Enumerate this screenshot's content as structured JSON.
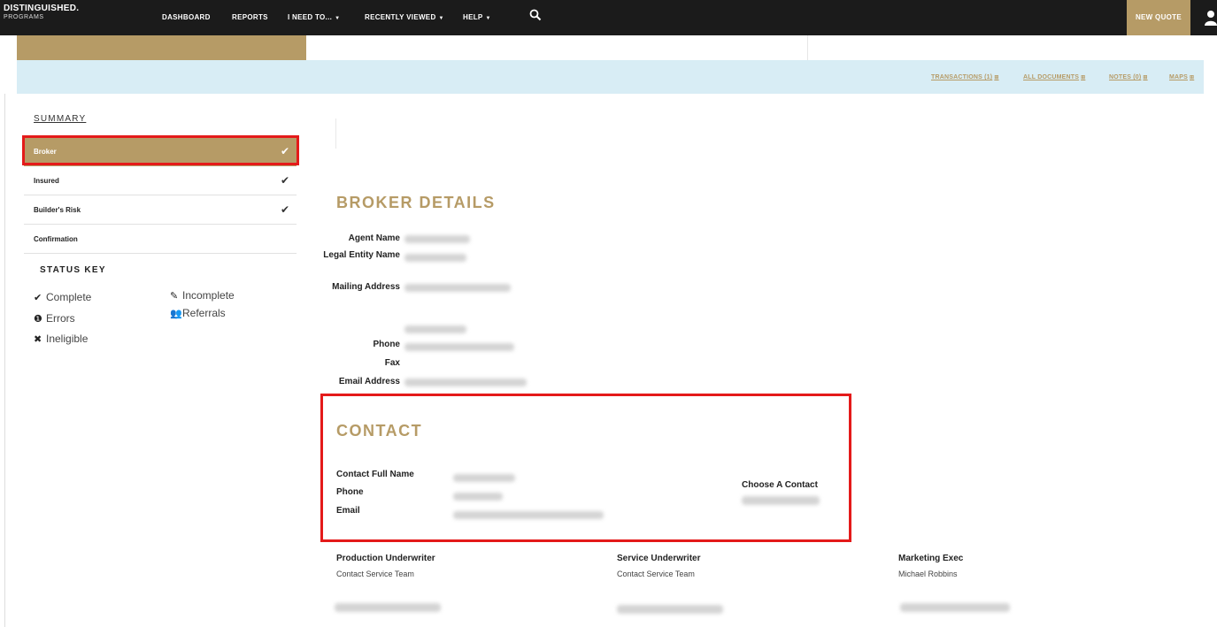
{
  "brand": {
    "line1": "DISTINGUISHED.",
    "line2": "PROGRAMS"
  },
  "nav": {
    "dashboard": "DASHBOARD",
    "reports": "REPORTS",
    "i_need_to": "I NEED TO...",
    "recently_viewed": "RECENTLY VIEWED",
    "help": "HELP",
    "new_quote": "NEW QUOTE"
  },
  "band_links": {
    "transactions": "TRANSACTIONS (1)",
    "all_documents": "ALL DOCUMENTS",
    "notes": "NOTES (0)",
    "maps": "MAPS"
  },
  "sidebar": {
    "summary": "SUMMARY",
    "steps": [
      {
        "label": "Broker",
        "done": true
      },
      {
        "label": "Insured",
        "done": true
      },
      {
        "label": "Builder's Risk",
        "done": true
      },
      {
        "label": "Confirmation",
        "done": false
      }
    ],
    "status_key": {
      "title": "STATUS KEY",
      "complete": "Complete",
      "incomplete": "Incomplete",
      "errors": "Errors",
      "referrals": "Referrals",
      "ineligible": "Ineligible"
    }
  },
  "broker": {
    "title": "BROKER DETAILS",
    "agent_name": "Agent Name",
    "legal_entity_name": "Legal Entity Name",
    "mailing_address": "Mailing Address",
    "phone": "Phone",
    "fax": "Fax",
    "email_address": "Email Address"
  },
  "contact": {
    "title": "CONTACT",
    "full_name": "Contact Full Name",
    "phone": "Phone",
    "email": "Email",
    "choose": "Choose A Contact"
  },
  "underwriters": {
    "production": {
      "title": "Production Underwriter",
      "value": "Contact Service Team"
    },
    "service": {
      "title": "Service Underwriter",
      "value": "Contact Service Team"
    },
    "marketing": {
      "title": "Marketing Exec",
      "value": "Michael Robbins"
    }
  }
}
